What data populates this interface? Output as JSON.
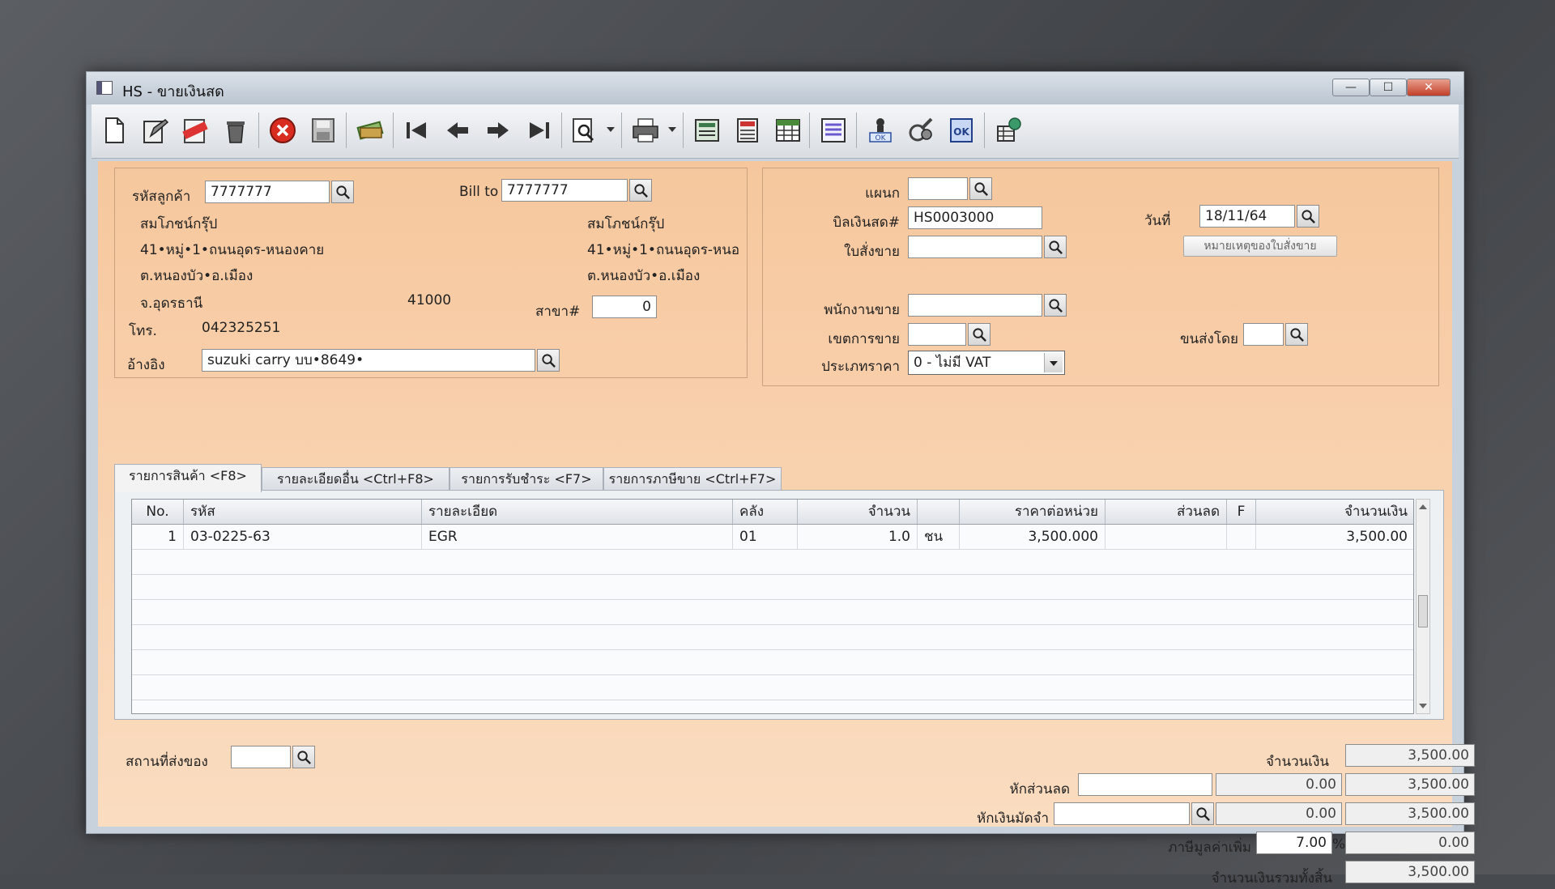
{
  "window": {
    "title": "HS - ขายเงินสด",
    "min": "—",
    "max": "☐",
    "close": "✕"
  },
  "toolbar": {
    "icons": [
      "new-doc-icon",
      "edit-icon",
      "void-icon",
      "trash-icon",
      "cancel-icon",
      "save-icon",
      "money-icon",
      "first-record-icon",
      "previous-record-icon",
      "next-record-icon",
      "last-record-icon",
      "search-doc-icon",
      "print-icon",
      "form-icon",
      "calculator-icon",
      "sheet-icon",
      "report-icon",
      "approve-icon",
      "tool-icon",
      "ok-icon",
      "network-icon"
    ]
  },
  "customer": {
    "code_label": "รหัสลูกค้า",
    "code": "7777777",
    "name": "สมโภชน์กรุ๊ป",
    "addr1": "41•หมู่•1•ถนนอุดร-หนองคาย",
    "addr2": "ต.หนองบัว•อ.เมือง",
    "province": "จ.อุดรธานี",
    "zip": "41000",
    "phone_label": "โทร.",
    "phone": "042325251",
    "ref_label": "อ้างอิง",
    "ref": "suzuki carry บบ•8649•"
  },
  "billto": {
    "label": "Bill to",
    "code": "7777777",
    "name": "สมโภชน์กรุ๊ป",
    "addr1": "41•หมู่•1•ถนนอุดร-หนอ",
    "addr2": "ต.หนองบัว•อ.เมือง",
    "branch_label": "สาขา#",
    "branch": "0"
  },
  "doc": {
    "dept_label": "แผนก",
    "dept": "",
    "bill_label": "บิลเงินสด#",
    "bill": "HS0003000",
    "date_label": "วันที่",
    "date": "18/11/64",
    "so_label": "ใบสั่งขาย",
    "so": "",
    "so_note_button": "หมายเหตุของใบสั่งขาย",
    "salesman_label": "พนักงานขาย",
    "salesman": "",
    "area_label": "เขตการขาย",
    "area": "",
    "ship_label": "ขนส่งโดย",
    "ship": "",
    "price_type_label": "ประเภทราคา",
    "price_type": "0 - ไม่มี VAT"
  },
  "tabs": [
    "รายการสินค้า <F8>",
    "รายละเอียดอื่น <Ctrl+F8>",
    "รายการรับชำระ <F7>",
    "รายการภาษีขาย <Ctrl+F7>"
  ],
  "grid": {
    "headers": [
      "No.",
      "รหัส",
      "รายละเอียด",
      "คลัง",
      "จำนวน",
      "",
      "ราคาต่อหน่วย",
      "ส่วนลด",
      "F",
      "จำนวนเงิน"
    ],
    "rows": [
      [
        "1",
        "03-0225-63",
        "EGR",
        "01",
        "1.0",
        "ชน",
        "3,500.000",
        "",
        "",
        "3,500.00"
      ]
    ]
  },
  "footer": {
    "delivery_label": "สถานที่ส่งของ",
    "delivery": "",
    "amount_label": "จำนวนเงิน",
    "amount": "3,500.00",
    "discount_label": "หักส่วนลด",
    "discount_text": "",
    "discount_value": "0.00",
    "after_discount": "3,500.00",
    "deposit_label": "หักเงินมัดจำ",
    "deposit_text": "",
    "deposit_value": "0.00",
    "after_deposit": "3,500.00",
    "vat_label": "ภาษีมูลค่าเพิ่ม",
    "vat_rate": "7.00",
    "vat_unit": "%",
    "vat_amount": "0.00",
    "total_label": "จำนวนเงินรวมทั้งสิ้น",
    "total": "3,500.00"
  }
}
